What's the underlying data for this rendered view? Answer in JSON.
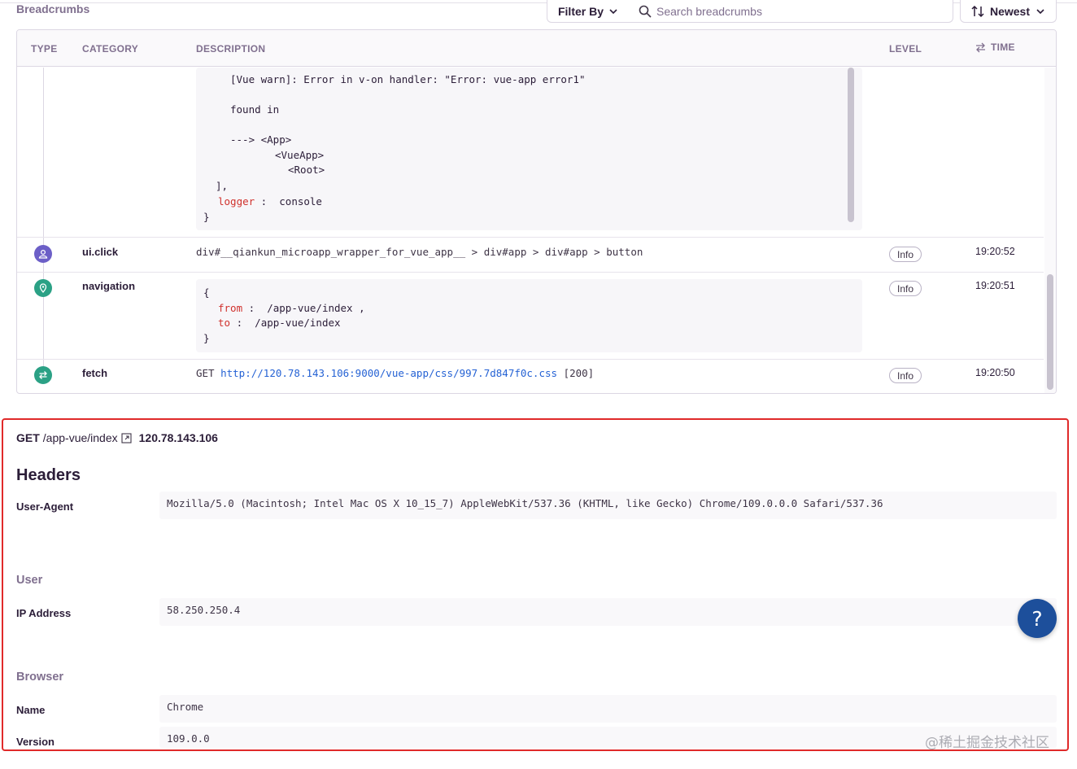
{
  "toolbar": {
    "title": "Breadcrumbs",
    "filter_label": "Filter By",
    "search_placeholder": "Search breadcrumbs",
    "sort_label": "Newest"
  },
  "table": {
    "headers": {
      "type": "TYPE",
      "category": "CATEGORY",
      "description": "DESCRIPTION",
      "level": "LEVEL",
      "time": "TIME"
    },
    "console_block": {
      "lines": [
        "[Vue warn]: Error in v-on handler: \"Error: vue-app error1\"",
        "found in",
        "---> <App>",
        "<VueApp>",
        "<Root>",
        "],"
      ],
      "logger_key": "logger",
      "logger_value": "console",
      "close_brace": "}"
    },
    "rows": [
      {
        "category": "ui.click",
        "description": "div#__qiankun_microapp_wrapper_for_vue_app__ > div#app > div#app > button",
        "level": "Info",
        "time": "19:20:52",
        "icon": "user-icon",
        "color": "#6c5fc7"
      },
      {
        "category": "navigation",
        "open_brace": "{",
        "from_key": "from",
        "from_value": "/app-vue/index",
        "to_key": "to",
        "to_value": "/app-vue/index",
        "close_brace": "}",
        "level": "Info",
        "time": "19:20:51",
        "icon": "location-pin-icon",
        "color": "#2ba185"
      },
      {
        "category": "fetch",
        "method": "GET",
        "url": "http://120.78.143.106:9000/vue-app/css/997.7d847f0c.css",
        "status": "[200]",
        "level": "Info",
        "time": "19:20:50",
        "icon": "arrows-swap-icon",
        "color": "#2ba185"
      }
    ]
  },
  "request": {
    "method": "GET",
    "path": "/app-vue/index",
    "host": "120.78.143.106"
  },
  "headers_section": {
    "title": "Headers",
    "user_agent_label": "User-Agent",
    "user_agent_value": "Mozilla/5.0 (Macintosh; Intel Mac OS X 10_15_7) AppleWebKit/537.36 (KHTML, like Gecko) Chrome/109.0.0.0 Safari/537.36"
  },
  "user_section": {
    "title": "User",
    "ip_label": "IP Address",
    "ip_value": "58.250.250.4"
  },
  "browser_section": {
    "title": "Browser",
    "name_label": "Name",
    "name_value": "Chrome",
    "version_label": "Version",
    "version_value": "109.0.0"
  },
  "help": {
    "label": "?"
  },
  "watermark": "@稀土掘金技术社区",
  "colors": {
    "accent_red": "#e02a2a",
    "help_blue": "#1d4f9b",
    "key_red": "#d0312d",
    "link_blue": "#2562d4"
  }
}
